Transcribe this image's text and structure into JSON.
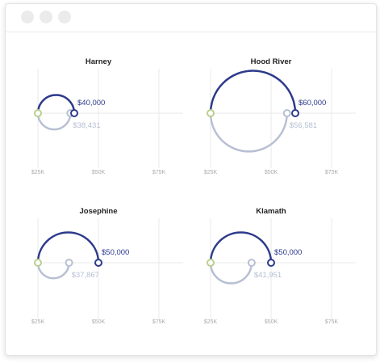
{
  "window": {
    "controls": [
      "close-dot",
      "minimize-dot",
      "maximize-dot"
    ]
  },
  "colors": {
    "current": "#2d3a8c",
    "previous": "#b7c0d3",
    "start_marker": "#b9d08e",
    "grid": "#e8e8e8",
    "tick_text": "#aaaaaa"
  },
  "chart_data": {
    "type": "arc",
    "xlim": [
      25000,
      75000
    ],
    "x_ticks": [
      {
        "value": 25000,
        "label": "$25K"
      },
      {
        "value": 50000,
        "label": "$50K"
      },
      {
        "value": 75000,
        "label": "$75K"
      }
    ],
    "baseline": 25000,
    "panels": [
      {
        "title": "Harney",
        "current": {
          "value": 40000,
          "label": "$40,000"
        },
        "previous": {
          "value": 38431,
          "label": "$38,431"
        }
      },
      {
        "title": "Hood River",
        "current": {
          "value": 60000,
          "label": "$60,000"
        },
        "previous": {
          "value": 56581,
          "label": "$56,581"
        }
      },
      {
        "title": "Josephine",
        "current": {
          "value": 50000,
          "label": "$50,000"
        },
        "previous": {
          "value": 37867,
          "label": "$37,867"
        }
      },
      {
        "title": "Klamath",
        "current": {
          "value": 50000,
          "label": "$50,000"
        },
        "previous": {
          "value": 41951,
          "label": "$41,951"
        }
      }
    ]
  }
}
